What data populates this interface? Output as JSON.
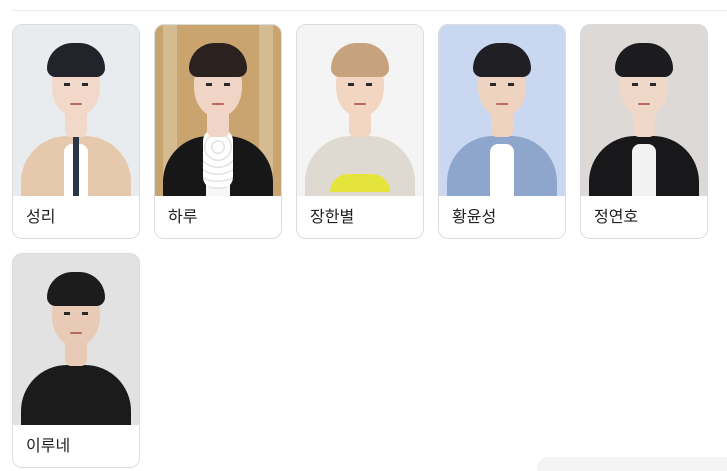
{
  "people": [
    {
      "name": "성리",
      "bg": "#e9ecef",
      "hair": "#23232b",
      "skin": "#f1d8c8",
      "outfit": "#e6c9ad",
      "inner": "#ffffff"
    },
    {
      "name": "하루",
      "bg": "#c9a46e",
      "hair": "#2b2220",
      "skin": "#f0d5c6",
      "outfit": "#171717",
      "inner": "#f7f7f7"
    },
    {
      "name": "장한별",
      "bg": "#f4f4f4",
      "hair": "#c6a37d",
      "skin": "#f2d6c2",
      "outfit": "#dedad2",
      "inner": "#dedad2"
    },
    {
      "name": "황윤성",
      "bg": "#c9d8f0",
      "hair": "#1f1f24",
      "skin": "#eed3c1",
      "outfit": "#8ea6cc",
      "inner": "#ffffff"
    },
    {
      "name": "정연호",
      "bg": "#ddd9d6",
      "hair": "#1c1c1f",
      "skin": "#f0d8c8",
      "outfit": "#18181a",
      "inner": "#f2f2f2"
    },
    {
      "name": "이루네",
      "bg": "#e2e2e2",
      "hair": "#1c1c1c",
      "skin": "#e8cab6",
      "outfit": "#1b1b1b",
      "inner": "#1b1b1b"
    }
  ]
}
